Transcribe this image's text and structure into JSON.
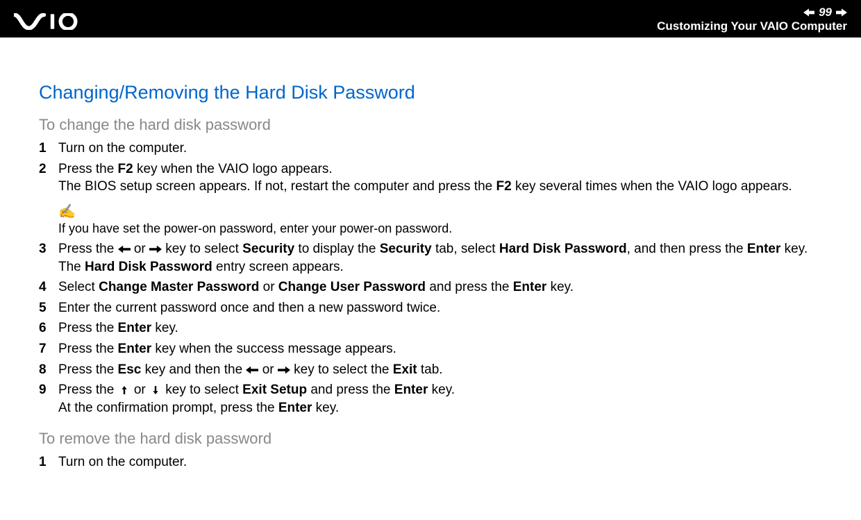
{
  "header": {
    "page_number": "99",
    "subtitle": "Customizing Your VAIO Computer"
  },
  "section_title": "Changing/Removing the Hard Disk Password",
  "subhead_change": "To change the hard disk password",
  "steps_change": {
    "s1": {
      "num": "1",
      "text": "Turn on the computer."
    },
    "s2": {
      "num": "2",
      "line1a": "Press the ",
      "line1b": "F2",
      "line1c": " key when the VAIO logo appears.",
      "line2a": "The BIOS setup screen appears. If not, restart the computer and press the ",
      "line2b": "F2",
      "line2c": " key several times when the VAIO logo appears."
    },
    "note": "If you have set the power-on password, enter your power-on password.",
    "s3": {
      "num": "3",
      "a": "Press the ",
      "b": " or ",
      "c": " key to select ",
      "d": "Security",
      "e": " to display the ",
      "f": "Security",
      "g": " tab, select ",
      "h": "Hard Disk Password",
      "i": ", and then press the ",
      "j": "Enter",
      "k": " key.",
      "line2a": "The ",
      "line2b": "Hard Disk Password",
      "line2c": " entry screen appears."
    },
    "s4": {
      "num": "4",
      "a": "Select ",
      "b": "Change Master Password",
      "c": " or ",
      "d": "Change User Password",
      "e": " and press the ",
      "f": "Enter",
      "g": " key."
    },
    "s5": {
      "num": "5",
      "text": "Enter the current password once and then a new password twice."
    },
    "s6": {
      "num": "6",
      "a": "Press the ",
      "b": "Enter",
      "c": " key."
    },
    "s7": {
      "num": "7",
      "a": "Press the ",
      "b": "Enter",
      "c": " key when the success message appears."
    },
    "s8": {
      "num": "8",
      "a": "Press the ",
      "b": "Esc",
      "c": " key and then the ",
      "d": " or ",
      "e": " key to select the ",
      "f": "Exit",
      "g": " tab."
    },
    "s9": {
      "num": "9",
      "a": "Press the ",
      "b": " or ",
      "c": " key to select ",
      "d": "Exit Setup",
      "e": " and press the ",
      "f": "Enter",
      "g": " key.",
      "line2a": "At the confirmation prompt, press the ",
      "line2b": "Enter",
      "line2c": " key."
    }
  },
  "subhead_remove": "To remove the hard disk password",
  "steps_remove": {
    "s1": {
      "num": "1",
      "text": "Turn on the computer."
    }
  }
}
